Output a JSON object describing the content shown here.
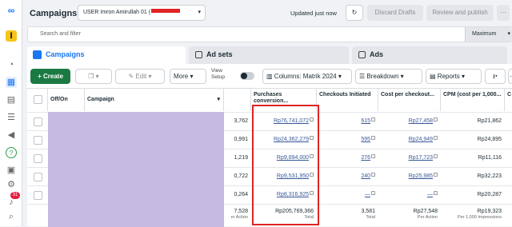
{
  "header": {
    "title": "Campaigns",
    "account": "USER Imron Amirullah 01 (",
    "status": "Updated just now",
    "discard": "Discard Drafts",
    "review": "Review and publish"
  },
  "filter": {
    "placeholder": "Search and filter",
    "range": "Maximum"
  },
  "tabs": [
    {
      "label": "Campaigns"
    },
    {
      "label": "Ad sets"
    },
    {
      "label": "Ads"
    }
  ],
  "toolbar": {
    "create": "Create",
    "edit": "Edit",
    "more": "More",
    "view_setup": "View Setup",
    "columns": "Columns: Matrik 2024",
    "breakdown": "Breakdown",
    "reports": "Reports"
  },
  "columns": {
    "offon": "Off/On",
    "campaign": "Campaign",
    "purchases": "Purchases conversion...",
    "checkouts": "Checkouts Initiated",
    "cpc": "Cost per checkout...",
    "cpm": "CPM (cost per 1,000..."
  },
  "rows": [
    {
      "prev": "3,762",
      "purch": "Rp76,741,072",
      "chk": "615",
      "cost": "Rp27,458",
      "cpm": "Rp21,862"
    },
    {
      "prev": "0,991",
      "purch": "Rp24,362,279",
      "chk": "595",
      "cost": "Rp24,949",
      "cpm": "Rp24,895"
    },
    {
      "prev": "1,219",
      "purch": "Rp9,894,000",
      "chk": "276",
      "cost": "Rp17,723",
      "cpm": "Rp11,116"
    },
    {
      "prev": "0,722",
      "purch": "Rp9,531,950",
      "chk": "240",
      "cpm": "Rp32,223",
      "cost": "Rp25,985"
    },
    {
      "prev": "0,264",
      "purch": "Rp8,316,925",
      "chk": "—",
      "cost": "—",
      "cpm": "Rp20,287"
    }
  ],
  "totals": {
    "prev": "7,528",
    "prev_sub": "er Action",
    "purch": "Rp205,769,366",
    "purch_sub": "Total",
    "chk": "3,581",
    "chk_sub": "Total",
    "cost": "Rp27,548",
    "cost_sub": "Per Action",
    "cpm": "Rp19,323",
    "cpm_sub": "Per 1,000 Impressions"
  },
  "notifications": "31",
  "colors": {
    "accent": "#1877f2",
    "create": "#1b7a43",
    "highlight": "#e02424",
    "redacted": "#c6b9e2"
  }
}
